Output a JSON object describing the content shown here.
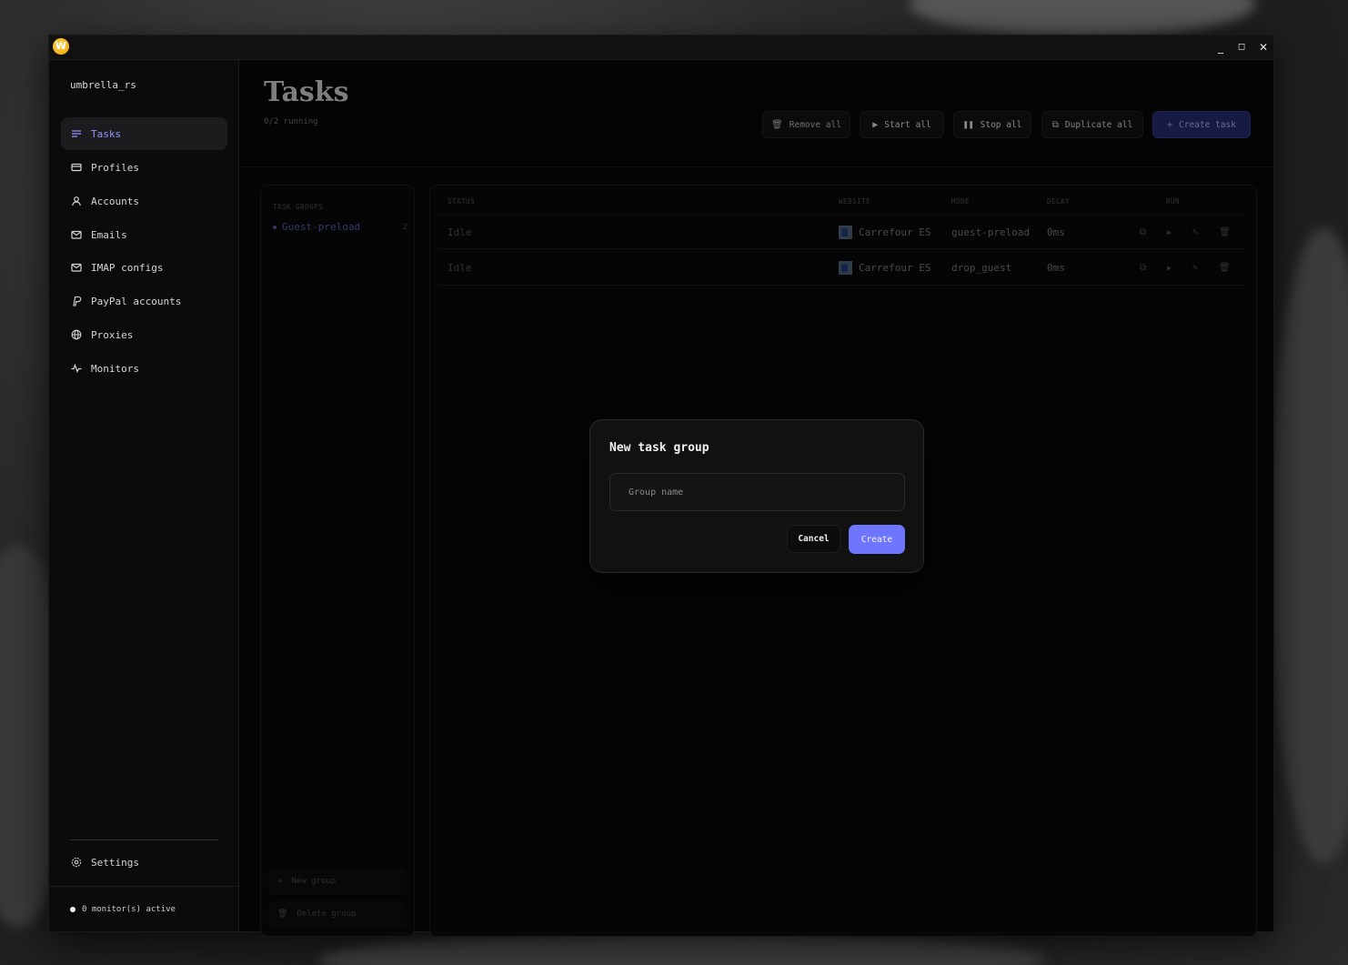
{
  "app": {
    "icon_letter": "W"
  },
  "window_controls": {
    "minimize": "_",
    "maximize": "◻",
    "close": "✕"
  },
  "sidebar": {
    "brand": "umbrella_rs",
    "items": [
      {
        "label": "Tasks",
        "icon": "list-icon",
        "active": true
      },
      {
        "label": "Profiles",
        "icon": "card-icon",
        "active": false
      },
      {
        "label": "Accounts",
        "icon": "user-icon",
        "active": false
      },
      {
        "label": "Emails",
        "icon": "mail-icon",
        "active": false
      },
      {
        "label": "IMAP configs",
        "icon": "mail-icon",
        "active": false
      },
      {
        "label": "PayPal accounts",
        "icon": "paypal-icon",
        "active": false
      },
      {
        "label": "Proxies",
        "icon": "globe-icon",
        "active": false
      },
      {
        "label": "Monitors",
        "icon": "activity-icon",
        "active": false
      }
    ],
    "settings_label": "Settings",
    "status_text": "0 monitor(s) active"
  },
  "header": {
    "title": "Tasks",
    "subtitle": "0/2 running",
    "buttons": {
      "remove_all": "Remove all",
      "start_all": "Start all",
      "stop_all": "Stop all",
      "duplicate_all": "Duplicate all",
      "create_task": "Create task"
    }
  },
  "groups": {
    "label": "TASK GROUPS",
    "items": [
      {
        "name": "Guest-preload",
        "count": "2"
      }
    ],
    "new_group": "New group",
    "delete_group": "Delete group"
  },
  "table": {
    "headers": {
      "status": "STATUS",
      "website": "WEBSITE",
      "mode": "MODE",
      "delay": "DELAY",
      "run": "RUN"
    },
    "rows": [
      {
        "status": "Idle",
        "website": "Carrefour ES",
        "mode": "guest-preload",
        "delay": "0ms"
      },
      {
        "status": "Idle",
        "website": "Carrefour ES",
        "mode": "drop_guest",
        "delay": "0ms"
      }
    ]
  },
  "modal": {
    "title": "New task group",
    "input_placeholder": "Group name",
    "input_value": "",
    "cancel_label": "Cancel",
    "create_label": "Create"
  },
  "colors": {
    "accent": "#6e76ff",
    "accent_active_text": "#8e95ff",
    "window_bg": "#050505",
    "sidebar_bg": "#0b0b0b"
  }
}
